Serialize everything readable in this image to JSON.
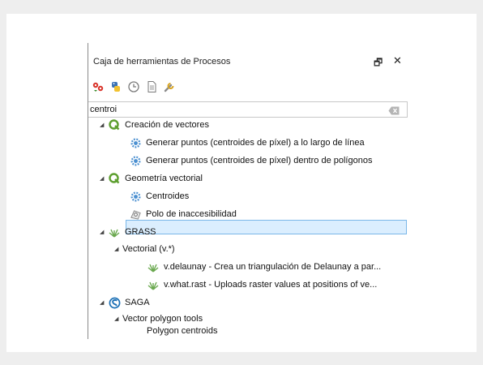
{
  "panel": {
    "title": "Caja de herramientas de Procesos",
    "float_glyph": "🗗",
    "close_glyph": "✕"
  },
  "toolbar": {
    "icons": [
      "models-icon",
      "python-scripts-icon",
      "history-icon",
      "results-icon",
      "options-icon"
    ]
  },
  "search": {
    "value": "centroi"
  },
  "tree": {
    "group_creacion": "Creación de vectores",
    "item_puntos_linea": "Generar puntos (centroides de píxel) a lo largo de línea",
    "item_puntos_poligonos": "Generar puntos (centroides de píxel) dentro de polígonos",
    "group_geometria": "Geometría vectorial",
    "item_centroides": "Centroides",
    "item_polo": "Polo de inaccesibilidad",
    "group_grass": "GRASS",
    "sub_vectorial": "Vectorial (v.*)",
    "item_delaunay": "v.delaunay - Crea un triangulación de Delaunay a par...",
    "item_whatrast": "v.what.rast - Uploads raster values at positions of ve...",
    "group_saga": "SAGA",
    "sub_vector_polygon": "Vector polygon tools",
    "item_polygon_centroids": "Polygon centroids",
    "selected_item": "Centroides"
  },
  "colors": {
    "selection_bg": "#dbeefe",
    "selection_border": "#7ab7e8",
    "qgis_green": "#5d9f2f",
    "saga_blue": "#1a6fb5",
    "gear_blue": "#4a8fd0"
  }
}
